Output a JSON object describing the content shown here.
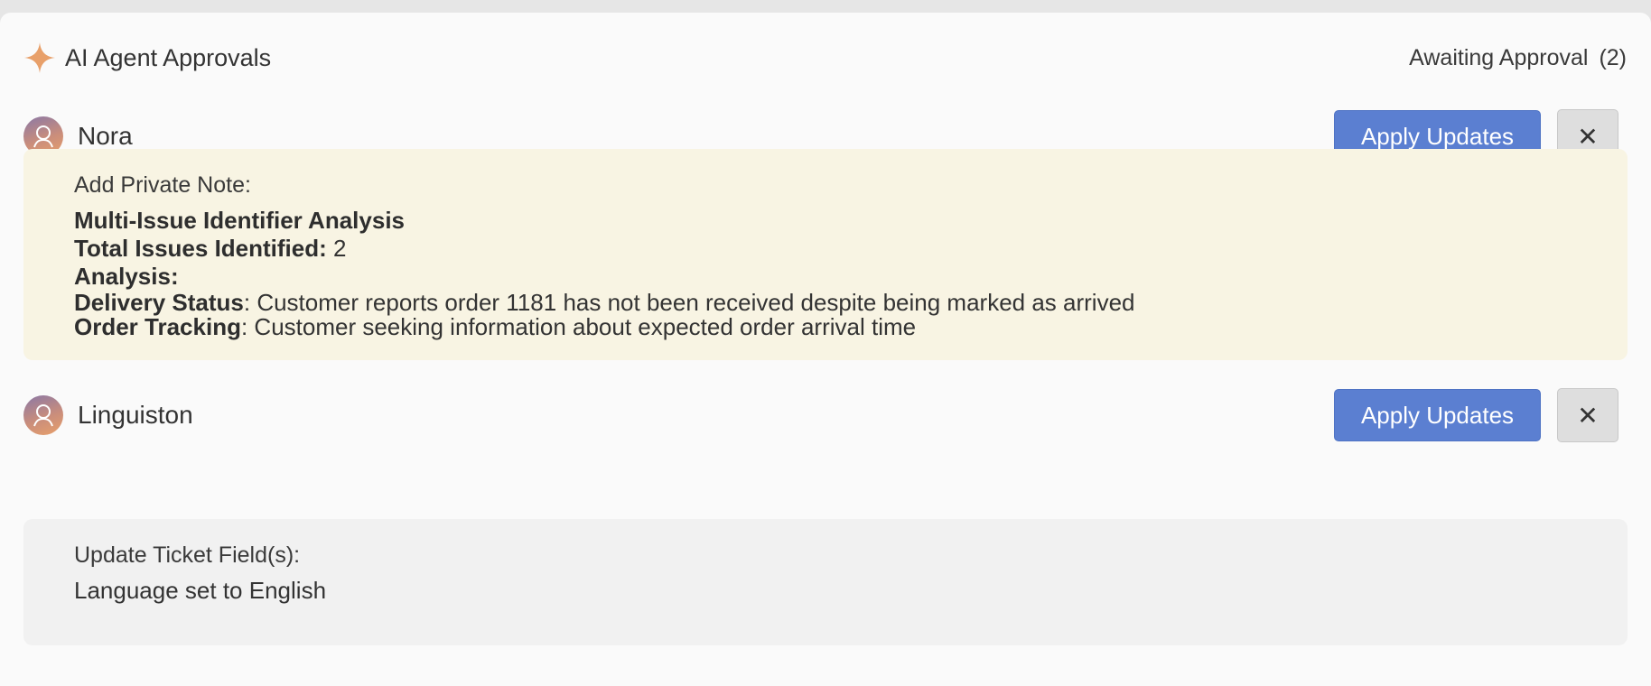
{
  "header": {
    "title": "AI Agent Approvals",
    "awaiting_label": "Awaiting Approval",
    "awaiting_count": "(2)",
    "accent_color": "#e8a06a"
  },
  "approvals": [
    {
      "agent_name": "Nora",
      "apply_label": "Apply Updates",
      "close_symbol": "✕",
      "card_color": "#f8f4e3",
      "heading": "Add Private Note:",
      "note_title": "Multi-Issue Identifier Analysis",
      "issues_label": "Total Issues Identified:",
      "issues_value": "2",
      "analysis_label": "Analysis:",
      "items": [
        {
          "label": "Delivery Status",
          "text": ": Customer reports order 1181 has not been received despite being marked as arrived"
        },
        {
          "label": "Order Tracking",
          "text": ": Customer seeking information about expected order arrival time"
        }
      ]
    },
    {
      "agent_name": "Linguiston",
      "apply_label": "Apply Updates",
      "close_symbol": "✕",
      "card_color": "#f1f1f1",
      "heading": "Update Ticket Field(s):",
      "field_name": "Language",
      "field_connector": "set to",
      "field_value": "English"
    }
  ],
  "colors": {
    "apply_button": "#5b7fd1",
    "close_button": "#dedede"
  }
}
